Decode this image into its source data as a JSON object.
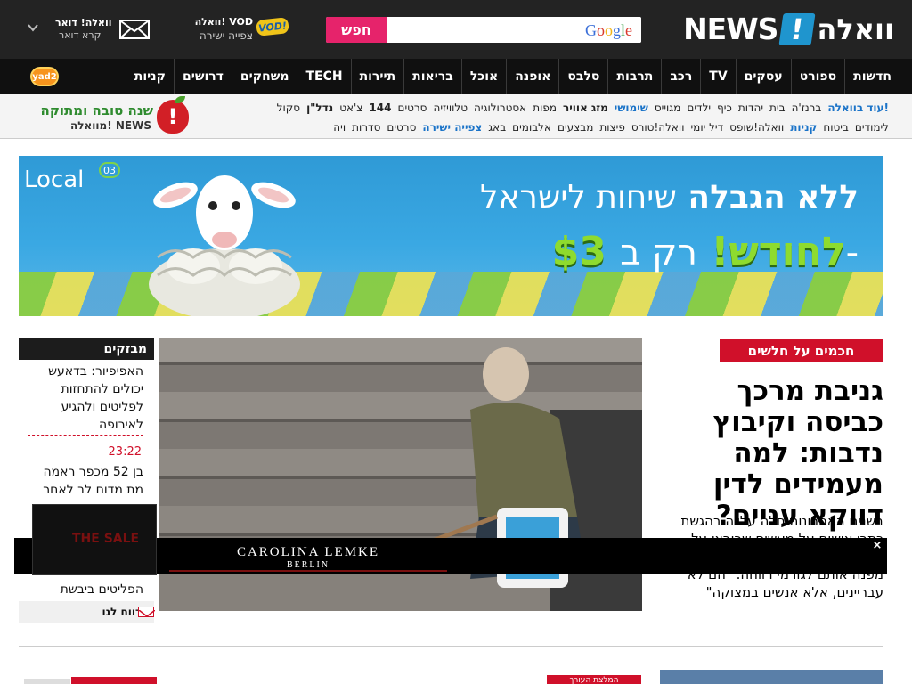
{
  "header": {
    "logo_text": "NEWS",
    "logo_heb": "וואלה",
    "logo_bang": "!",
    "search": {
      "button_label": "חפש",
      "input_value": "",
      "placeholder": "",
      "provider": "Google"
    },
    "vod": {
      "title": "וואלה! VOD",
      "subtitle": "צפייה ישירה",
      "badge": "VOD!"
    },
    "mail": {
      "title": "וואלה! דואר",
      "subtitle": "קרא דואר"
    }
  },
  "main_nav": {
    "items": [
      "חדשות",
      "ספורט",
      "עסקים",
      "TV",
      "רכב",
      "תרבות",
      "סלבס",
      "אופנה",
      "אוכל",
      "בריאות",
      "תיירות",
      "TECH",
      "משחקים",
      "דרושים",
      "קניות"
    ],
    "yad2_label": "yad2"
  },
  "sub_links": {
    "row1": [
      "עוד בוואלה!",
      "ברנז'ה",
      "בית",
      "יהדות",
      "כיף",
      "ילדים",
      "מגוייס",
      "שימושי",
      "מזג אוויר",
      "מפות",
      "אסטרולוגיה",
      "טלוויזיה",
      "סרטים",
      "144",
      "צ'אט",
      "נדל\"ן",
      "סקול"
    ],
    "row2": [
      "לימודים",
      "ביטוח",
      "קניות",
      "וואלה!שופס",
      "דיל יומי",
      "וואלה!טורס",
      "פיצות",
      "מבצעים",
      "אלבומים",
      "באג",
      "צפייה ישירה",
      "סרטים",
      "סדרות",
      "ויה"
    ]
  },
  "promo": {
    "greeting": "שנה טובה ומתוקה",
    "brand": "מוואלה! NEWS"
  },
  "banner": {
    "logo": "Local",
    "logo_badge": "03",
    "line1_light": "שיחות לישראל",
    "line1_strong": "ללא הגבלה",
    "line2_prefix": "רק ב-",
    "line2_price": "$3 לחודש!"
  },
  "article": {
    "badge": "חכמים על חלשים",
    "headline": "גניבת מרכך כביסה וקיבוץ נדבות: למה מעמידים לדין דווקא עניים?",
    "teaser": "בשנים האחרונות חלה עלייה בהגשת כתבי אישום על מעשים שרובצו על ... צריכים להגיע למשפט, אך המשטרה לא מפנה אותם לגורמי רווחה. \"הם לא עבריינים, אלא אנשים במצוקה\""
  },
  "breaking": {
    "title": "מבזקים",
    "items": [
      {
        "time": "",
        "text": "האפיפיור: בדאעש יכולים להתחזות לפליטים ולהגיע לאירופה"
      },
      {
        "time": "23:22",
        "text": "בן 52 מכפר ראמה מת מדום לב לאחר ..."
      },
      {
        "time": "",
        "text": "הפליטים ביבשת"
      }
    ],
    "report_label": "דווח לנו"
  },
  "overlay_ad": {
    "thumb_text": "THE SALE",
    "brand": "CAROLINA LEMKE",
    "city": "BERLIN",
    "close": "×"
  },
  "bottom": {
    "section_label": "המלצת העורך"
  },
  "colors": {
    "brand_red": "#d0102a",
    "search_pink": "#e6236b",
    "walla_blue": "#1f95ce",
    "header_bg": "#232323",
    "nav_bg": "#101010"
  }
}
